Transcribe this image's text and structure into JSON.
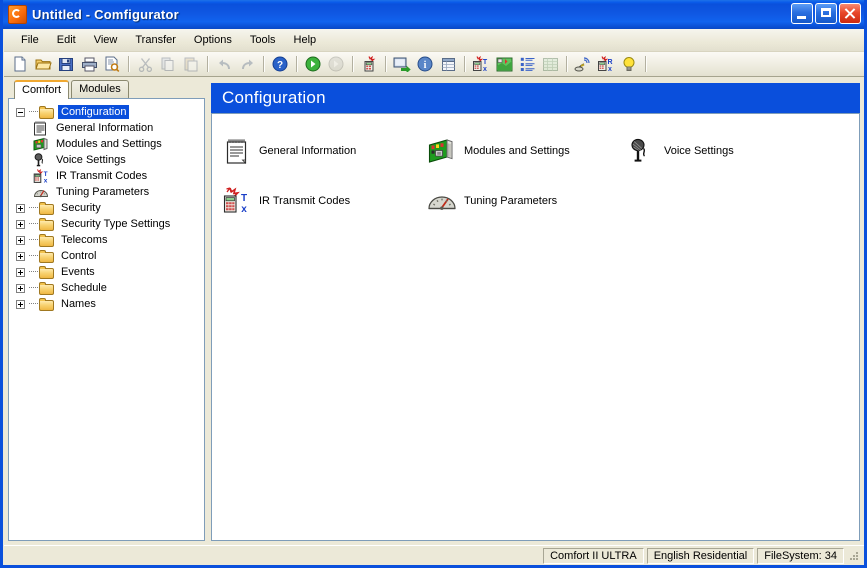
{
  "window": {
    "title": "Untitled - Comfigurator",
    "app_icon": "comfigurator-logo-icon",
    "controls": {
      "minimize": "Minimize",
      "maximize": "Maximize",
      "close": "Close"
    }
  },
  "menubar": {
    "items": [
      {
        "label": "File"
      },
      {
        "label": "Edit"
      },
      {
        "label": "View"
      },
      {
        "label": "Transfer"
      },
      {
        "label": "Options"
      },
      {
        "label": "Tools"
      },
      {
        "label": "Help"
      }
    ]
  },
  "toolbar": {
    "buttons": [
      {
        "name": "new-document-icon",
        "enabled": true
      },
      {
        "name": "open-folder-icon",
        "enabled": true
      },
      {
        "name": "save-disk-icon",
        "enabled": true
      },
      {
        "name": "print-icon",
        "enabled": true
      },
      {
        "name": "print-preview-icon",
        "enabled": true
      },
      {
        "name": "cut-scissors-icon",
        "enabled": false
      },
      {
        "name": "copy-icon",
        "enabled": false
      },
      {
        "name": "paste-icon",
        "enabled": false
      },
      {
        "name": "undo-arrow-icon",
        "enabled": false
      },
      {
        "name": "redo-arrow-icon",
        "enabled": false
      },
      {
        "name": "help-question-icon",
        "enabled": true
      },
      {
        "name": "connect-green-icon",
        "enabled": true
      },
      {
        "name": "disconnect-gray-icon",
        "enabled": false
      },
      {
        "name": "counter-device-icon",
        "enabled": true
      },
      {
        "name": "send-to-device-icon",
        "enabled": true
      },
      {
        "name": "information-icon",
        "enabled": true
      },
      {
        "name": "table-grid-icon",
        "enabled": true
      },
      {
        "name": "ir-transmit-icon",
        "enabled": true
      },
      {
        "name": "map-zone-icon",
        "enabled": true
      },
      {
        "name": "list-items-icon",
        "enabled": true
      },
      {
        "name": "spreadsheet-icon",
        "enabled": false
      },
      {
        "name": "security-scan-icon",
        "enabled": true
      },
      {
        "name": "ir-receive-icon",
        "enabled": true
      },
      {
        "name": "light-bulb-icon",
        "enabled": true
      }
    ]
  },
  "left_pane": {
    "tabs": [
      {
        "label": "Comfort",
        "active": true
      },
      {
        "label": "Modules",
        "active": false
      }
    ],
    "tree": [
      {
        "label": "Configuration",
        "level": 0,
        "expander": "minus",
        "icon": "folder-open-icon",
        "selected": true
      },
      {
        "label": "General Information",
        "level": 1,
        "icon": "document-notepad-icon"
      },
      {
        "label": "Modules and Settings",
        "level": 1,
        "icon": "circuit-board-icon"
      },
      {
        "label": "Voice Settings",
        "level": 1,
        "icon": "microphone-icon"
      },
      {
        "label": "IR Transmit Codes",
        "level": 1,
        "icon": "ir-transmit-icon"
      },
      {
        "label": "Tuning Parameters",
        "level": 1,
        "icon": "gauge-icon"
      },
      {
        "label": "Security",
        "level": 0,
        "expander": "plus",
        "icon": "folder-icon"
      },
      {
        "label": "Security Type Settings",
        "level": 0,
        "expander": "plus",
        "icon": "folder-icon"
      },
      {
        "label": "Telecoms",
        "level": 0,
        "expander": "plus",
        "icon": "folder-icon"
      },
      {
        "label": "Control",
        "level": 0,
        "expander": "plus",
        "icon": "folder-icon"
      },
      {
        "label": "Events",
        "level": 0,
        "expander": "plus",
        "icon": "folder-icon"
      },
      {
        "label": "Schedule",
        "level": 0,
        "expander": "plus",
        "icon": "folder-icon"
      },
      {
        "label": "Names",
        "level": 0,
        "expander": "plus",
        "icon": "folder-icon"
      }
    ]
  },
  "content": {
    "header": "Configuration",
    "items": [
      {
        "label": "General Information",
        "icon": "document-notepad-icon"
      },
      {
        "label": "Modules and Settings",
        "icon": "circuit-board-icon"
      },
      {
        "label": "Voice Settings",
        "icon": "microphone-icon"
      },
      {
        "label": "IR Transmit Codes",
        "icon": "ir-transmit-icon"
      },
      {
        "label": "Tuning Parameters",
        "icon": "gauge-icon"
      }
    ]
  },
  "statusbar": {
    "panes": [
      {
        "text": "Comfort II ULTRA"
      },
      {
        "text": "English Residential"
      },
      {
        "text": "FileSystem: 34"
      }
    ]
  },
  "colors": {
    "title_blue": "#0a50dc",
    "header_blue": "#0a4fdc",
    "selection_blue": "#0a4fdc",
    "face": "#ece9d8",
    "tab_accent": "#f0a830"
  }
}
